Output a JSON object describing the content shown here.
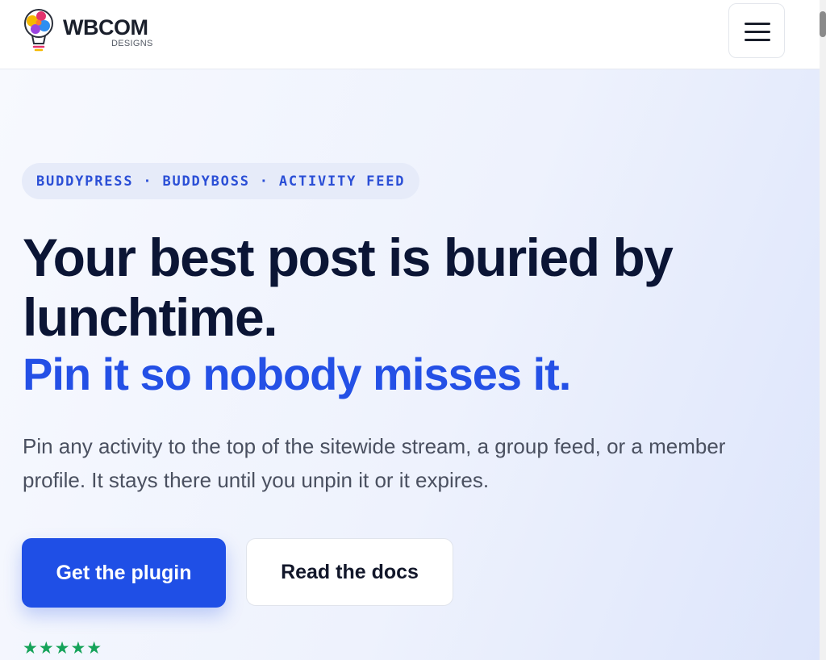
{
  "header": {
    "logo_title": "WBCOM",
    "logo_subtitle": "DESIGNS",
    "menu_icon": "hamburger-menu-icon"
  },
  "hero": {
    "tagline": "BUDDYPRESS · BUDDYBOSS · ACTIVITY FEED",
    "headline": "Your best post is buried by lunchtime.",
    "subheadline": "Pin it so nobody misses it.",
    "description": "Pin any activity to the top of the sitewide stream, a group feed, or a member profile. It stays there until you unpin it or it expires.",
    "primary_button": "Get the plugin",
    "secondary_button": "Read the docs",
    "rating": {
      "stars_shown": 5,
      "glyphs": "★★★★★"
    }
  },
  "colors": {
    "accent_blue": "#1f4fe6",
    "headline_navy": "#0b1535",
    "star_green": "#16a35a"
  }
}
